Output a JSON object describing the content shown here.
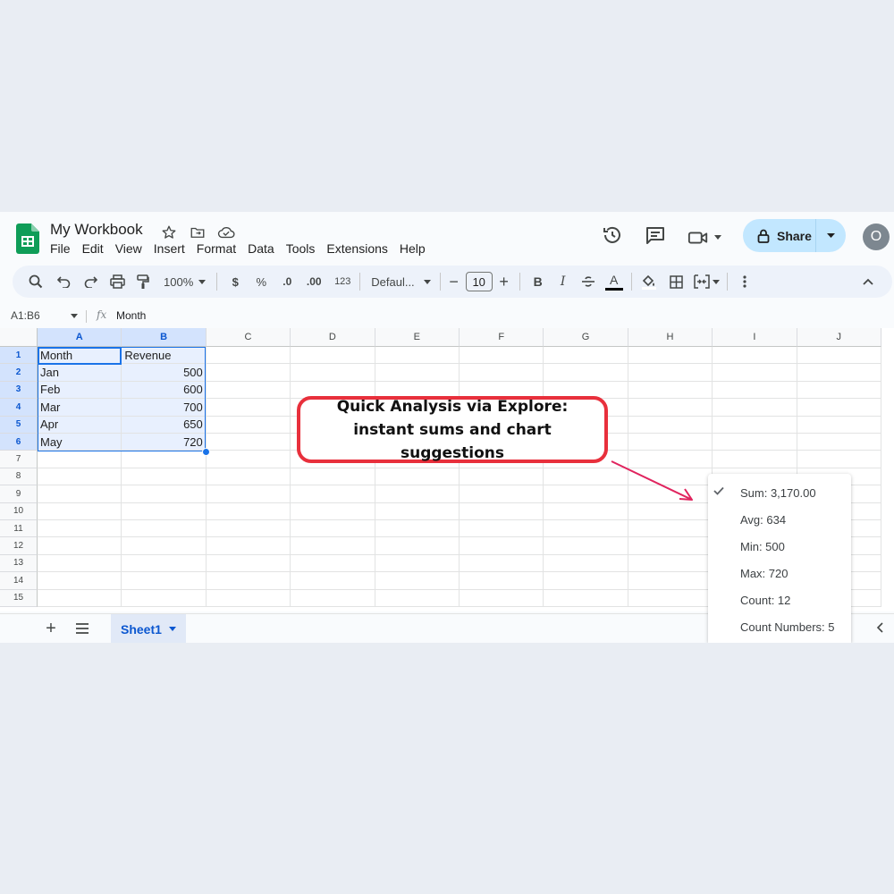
{
  "app": {
    "title": "My Workbook",
    "menu": [
      "File",
      "Edit",
      "View",
      "Insert",
      "Format",
      "Data",
      "Tools",
      "Extensions",
      "Help"
    ],
    "share_label": "Share",
    "avatar_initial": "O"
  },
  "toolbar": {
    "zoom": "100%",
    "currency": "$",
    "percent": "%",
    "decrease_decimal": ".0",
    "increase_decimal": ".00",
    "number_format": "123",
    "font": "Defaul...",
    "font_size": "10",
    "bold": "B",
    "italic": "I",
    "text_color_letter": "A"
  },
  "formula_bar": {
    "name_box": "A1:B6",
    "fx": "fx",
    "value": "Month"
  },
  "grid": {
    "columns": [
      "A",
      "B",
      "C",
      "D",
      "E",
      "F",
      "G",
      "H",
      "I",
      "J"
    ],
    "rows": [
      "1",
      "2",
      "3",
      "4",
      "5",
      "6",
      "7",
      "8",
      "9",
      "10",
      "11",
      "12",
      "13",
      "14",
      "15"
    ],
    "cells": [
      [
        "Month",
        "Revenue"
      ],
      [
        "Jan",
        "500"
      ],
      [
        "Feb",
        "600"
      ],
      [
        "Mar",
        "700"
      ],
      [
        "Apr",
        "650"
      ],
      [
        "May",
        "720"
      ]
    ]
  },
  "sheets": {
    "active": "Sheet1"
  },
  "summary": {
    "items": [
      "Sum: 3,170.00",
      "Avg: 634",
      "Min: 500",
      "Max: 720",
      "Count: 12",
      "Count Numbers: 5"
    ]
  },
  "callout": {
    "text": "Quick Analysis via Explore: instant sums and chart suggestions"
  },
  "colors": {
    "accent": "#1a73e8",
    "share_bg": "#c2e7ff",
    "callout_border": "#e8303c"
  }
}
